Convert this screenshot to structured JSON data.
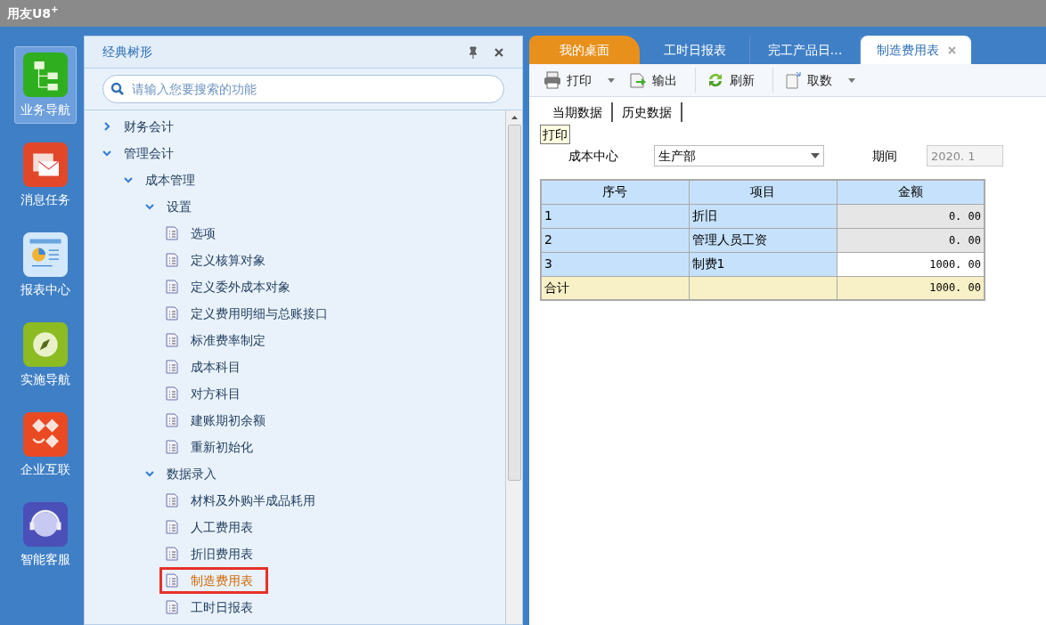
{
  "app_title": "用友U8$^{+}$",
  "nav": [
    {
      "label": "业务导航",
      "kind": "tree",
      "selected": true
    },
    {
      "label": "消息任务",
      "kind": "mail",
      "selected": false
    },
    {
      "label": "报表中心",
      "kind": "report",
      "selected": false
    },
    {
      "label": "实施导航",
      "kind": "compass",
      "selected": false
    },
    {
      "label": "企业互联",
      "kind": "connect",
      "selected": false
    },
    {
      "label": "智能客服",
      "kind": "service",
      "selected": false
    }
  ],
  "tree_panel": {
    "title": "经典树形",
    "search": {
      "placeholder": "请输入您要搜索的功能"
    },
    "items": [
      {
        "label": "财务会计",
        "expanded": false
      },
      {
        "label": "管理会计",
        "expanded": true,
        "children": [
          {
            "label": "成本管理",
            "expanded": true,
            "children": [
              {
                "label": "设置",
                "expanded": true,
                "children": [
                  {
                    "label": "选项",
                    "selected": false
                  },
                  {
                    "label": "定义核算对象",
                    "selected": false
                  },
                  {
                    "label": "定义委外成本对象",
                    "selected": false
                  },
                  {
                    "label": "定义费用明细与总账接口",
                    "selected": false
                  },
                  {
                    "label": "标准费率制定",
                    "selected": false
                  },
                  {
                    "label": "成本科目",
                    "selected": false
                  },
                  {
                    "label": "对方科目",
                    "selected": false
                  },
                  {
                    "label": "建账期初余额",
                    "selected": false
                  },
                  {
                    "label": "重新初始化",
                    "selected": false
                  }
                ]
              },
              {
                "label": "数据录入",
                "expanded": true,
                "children": [
                  {
                    "label": "材料及外购半成品耗用",
                    "selected": false
                  },
                  {
                    "label": "人工费用表",
                    "selected": false
                  },
                  {
                    "label": "折旧费用表",
                    "selected": false
                  },
                  {
                    "label": "制造费用表",
                    "selected": true
                  },
                  {
                    "label": "工时日报表",
                    "selected": false
                  }
                ]
              }
            ]
          }
        ]
      }
    ]
  },
  "tabs": [
    {
      "label": "我的桌面",
      "kind": "home",
      "selected": false
    },
    {
      "label": "工时日报表",
      "kind": "doc",
      "selected": false
    },
    {
      "label": "完工产品日…",
      "kind": "doc",
      "selected": false
    },
    {
      "label": "制造费用表",
      "kind": "doc",
      "selected": true
    }
  ],
  "toolbar": [
    {
      "label": "打印",
      "kind": "print",
      "dropdown": true
    },
    {
      "label": "输出",
      "kind": "export",
      "dropdown": false
    },
    {
      "label": "刷新",
      "kind": "refresh",
      "dropdown": false
    },
    {
      "label": "取数",
      "kind": "fetch",
      "dropdown": true
    }
  ],
  "sub_tabs": [
    {
      "label": "当期数据"
    },
    {
      "label": "历史数据"
    }
  ],
  "tooltip": "打印",
  "filter": {
    "cost_center": {
      "label": "成本中心",
      "value": "生产部"
    },
    "period": {
      "label": "期间",
      "value": "2020. 1",
      "disabled": true
    }
  },
  "table": {
    "columns": [
      "序号",
      "项目",
      "金额"
    ],
    "rows": [
      {
        "kind": "data",
        "editable": false,
        "cells": [
          "1",
          "折旧",
          "0. 00"
        ]
      },
      {
        "kind": "data",
        "editable": false,
        "cells": [
          "2",
          "管理人员工资",
          "0. 00"
        ]
      },
      {
        "kind": "data",
        "editable": true,
        "cells": [
          "3",
          "制费1",
          "1000. 00"
        ]
      },
      {
        "kind": "total",
        "cells": [
          "合计",
          "",
          "1000. 00"
        ]
      }
    ]
  }
}
